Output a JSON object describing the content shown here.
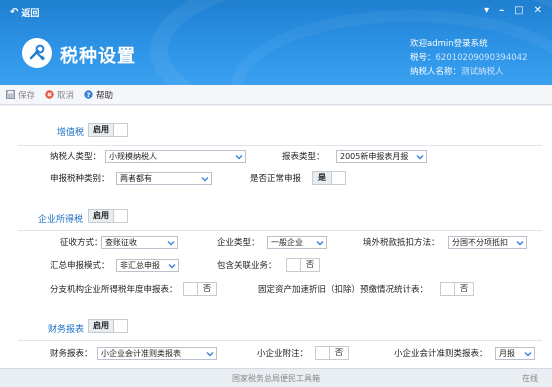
{
  "header": {
    "back_label": "返回",
    "title": "税种设置",
    "welcome": "欢迎admin登录系统",
    "tax_no_label": "税号：",
    "tax_no": "62010209090394042",
    "taxpayer_label": "纳税人名称：",
    "taxpayer_name": "测试纳税人"
  },
  "toolbar": {
    "save_label": "保存",
    "cancel_label": "取消",
    "help_label": "帮助"
  },
  "vat": {
    "title": "增值税",
    "enabled_label": "启用",
    "taxpayer_type_label": "纳税人类型：",
    "taxpayer_type_value": "小规模纳税人",
    "report_type_label": "报表类型：",
    "report_type_value": "2005新申报表月报",
    "declare_kind_label": "申报税种类别：",
    "declare_kind_value": "两者都有",
    "normal_declare_label": "是否正常申报",
    "normal_declare_value": "是"
  },
  "cit": {
    "title": "企业所得税",
    "enabled_label": "启用",
    "collect_label": "征收方式：",
    "collect_value": "查账征收",
    "company_type_label": "企业类型：",
    "company_type_value": "一般企业",
    "overseas_label": "境外税款抵扣方法：",
    "overseas_value": "分国不分项抵扣",
    "summary_mode_label": "汇总申报模式：",
    "summary_mode_value": "非汇总申报",
    "related_label": "包含关联业务：",
    "related_value": "否",
    "branch_label": "分支机构企业所得税年度申报表：",
    "branch_value": "否",
    "fixed_asset_label": "固定资产加速折旧（扣除）预缴情况统计表：",
    "fixed_asset_value": "否"
  },
  "fin": {
    "title": "财务报表",
    "enabled_label": "启用",
    "report_label": "财务报表：",
    "report_value": "小企业会计准则类报表",
    "small_note_label": "小企业附注：",
    "small_note_value": "否",
    "acct_std_label": "小企业会计准则类报表：",
    "acct_std_value": "月报"
  },
  "footer": {
    "center": "国家税务总局便民工具箱",
    "status": "在线"
  },
  "colors": {
    "header_blue": "#2d93e6",
    "section_blue": "#1a6fc4"
  }
}
